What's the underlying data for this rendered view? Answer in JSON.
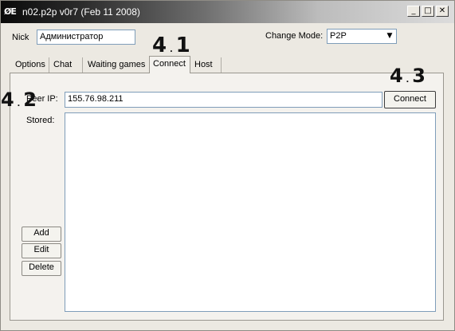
{
  "window": {
    "title": "n02.p2p v0r7 (Feb 11 2008)",
    "app_icon": "ØE",
    "controls": {
      "minimize": "_",
      "maximize": "□",
      "close": "✕"
    }
  },
  "header": {
    "nick_label": "Nick",
    "nick_value": "Администратор",
    "mode_label": "Change Mode:",
    "mode_value": "P2P",
    "mode_arrow": "▼"
  },
  "tabs": [
    {
      "label": "Options",
      "active": false
    },
    {
      "label": "Chat",
      "active": false
    },
    {
      "label": "Waiting games",
      "active": false
    },
    {
      "label": "Connect",
      "active": true
    },
    {
      "label": "Host",
      "active": false
    }
  ],
  "connect": {
    "peer_ip_label": "Peer IP:",
    "peer_ip_value": "155.76.98.211",
    "connect_button": "Connect",
    "stored_label": "Stored:",
    "stored_items": [],
    "add_button": "Add",
    "edit_button": "Edit",
    "delete_button": "Delete"
  },
  "annotations": {
    "a1_big": "4",
    "a1_small": "1",
    "a2_big": "4",
    "a2_small": "2",
    "a3_big": "4",
    "a3_small": "3"
  }
}
